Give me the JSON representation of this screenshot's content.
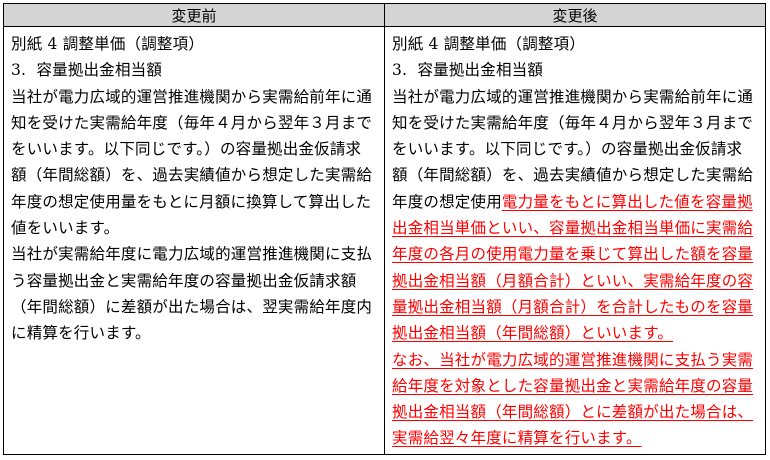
{
  "headers": {
    "before": "変更前",
    "after": "変更後"
  },
  "before": {
    "heading": "別紙 4 調整単価（調整項）",
    "subheading": "3.  容量拠出金相当額",
    "lines": [
      "当社が電力広域的運営推進機関から実需給前年に通",
      "知を受けた実需給年度（毎年４月から翌年３月まで",
      "をいいます。以下同じです。）の容量拠出金仮請求",
      "額（年間総額）を、過去実績値から想定した実需給",
      "年度の想定使用量をもとに月額に換算して算出した",
      "値をいいます。",
      "当社が実需給年度に電力広域的運営推進機関に支払",
      "う容量拠出金と実需給年度の容量拠出金仮請求額",
      "（年間総額）に差額が出た場合は、翌実需給年度内",
      "に精算を行います。"
    ]
  },
  "after": {
    "heading": "別紙 4 調整単価（調整項）",
    "subheading": "3.  容量拠出金相当額",
    "lines": [
      "当社が電力広域的運営推進機関から実需給前年に通",
      "知を受けた実需給年度（毎年４月から翌年３月まで",
      "をいいます。以下同じです。）の容量拠出金仮請求",
      "額（年間総額）を、過去実績値から想定した実需給"
    ],
    "line5_prefix": "年度の想定使用",
    "line5_changed": "電力量をもとに算出した値を容量拠",
    "changed_lines": [
      "出金相当単価といい、容量拠出金相当単価に実需給",
      "年度の各月の使用電力量を乗じて算出した額を容量",
      "拠出金相当額（月額合計）といい、実需給年度の容",
      "量拠出金相当額（月額合計）を合計したものを容量",
      "拠出金相当額（年間総額）といいます。",
      "なお、当社が電力広域的運営推進機関に支払う実需",
      "給年度を対象とした容量拠出金と実需給年度の容量",
      "拠出金相当額（年間総額）とに差額が出た場合は、",
      "実需給翌々年度に精算を行います。"
    ]
  },
  "colors": {
    "header_bg": "#d4d4d4",
    "changed_text": "#ff0000",
    "border": "#000000"
  }
}
